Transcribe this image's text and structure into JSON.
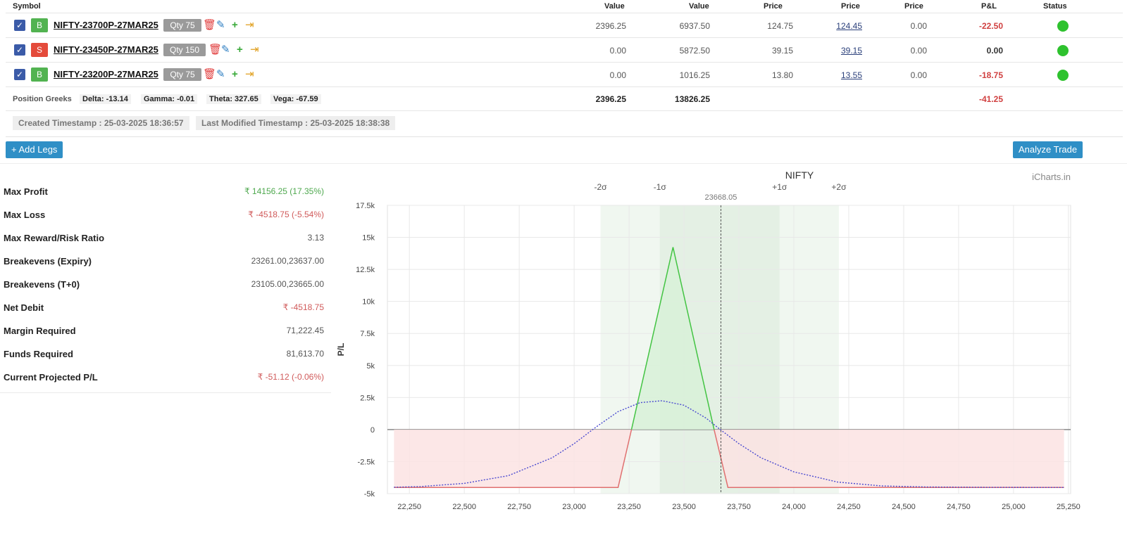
{
  "table": {
    "headers": {
      "symbol": "Symbol",
      "value1": "Value",
      "value2": "Value",
      "price1": "Price",
      "price2": "Price",
      "price3": "Price",
      "pnl": "P&L",
      "status": "Status"
    },
    "rows": [
      {
        "side": "B",
        "symbol": "NIFTY-23700P-27MAR25",
        "qty": "Qty 75",
        "v1": "2396.25",
        "v2": "6937.50",
        "p1": "124.75",
        "p2": "124.45",
        "p3": "0.00",
        "pnl": "-22.50"
      },
      {
        "side": "S",
        "symbol": "NIFTY-23450P-27MAR25",
        "qty": "Qty 150",
        "v1": "0.00",
        "v2": "5872.50",
        "p1": "39.15",
        "p2": "39.15",
        "p3": "0.00",
        "pnl": "0.00"
      },
      {
        "side": "B",
        "symbol": "NIFTY-23200P-27MAR25",
        "qty": "Qty 75",
        "v1": "0.00",
        "v2": "1016.25",
        "p1": "13.80",
        "p2": "13.55",
        "p3": "0.00",
        "pnl": "-18.75"
      }
    ],
    "greeks": {
      "label": "Position Greeks",
      "delta": "Delta: -13.14",
      "gamma": "Gamma: -0.01",
      "theta": "Theta: 327.65",
      "vega": "Vega: -67.59",
      "total_v1": "2396.25",
      "total_v2": "13826.25",
      "total_pnl": "-41.25"
    },
    "created": "Created Timestamp : 25-03-2025 18:36:57",
    "modified": "Last Modified Timestamp : 25-03-2025 18:38:38"
  },
  "buttons": {
    "add_legs": "+ Add Legs",
    "analyze": "Analyze Trade"
  },
  "stats": [
    {
      "label": "Max Profit",
      "value": "₹ 14156.25 (17.35%)",
      "tone": "pos"
    },
    {
      "label": "Max Loss",
      "value": "₹ -4518.75 (-5.54%)",
      "tone": "neg"
    },
    {
      "label": "Max Reward/Risk Ratio",
      "value": "3.13",
      "tone": ""
    },
    {
      "label": "Breakevens (Expiry)",
      "value": "23261.00,23637.00",
      "tone": ""
    },
    {
      "label": "Breakevens (T+0)",
      "value": "23105.00,23665.00",
      "tone": ""
    },
    {
      "label": "Net Debit",
      "value": "₹ -4518.75",
      "tone": "neg"
    },
    {
      "label": "Margin Required",
      "value": "71,222.45",
      "tone": ""
    },
    {
      "label": "Funds Required",
      "value": "81,613.70",
      "tone": ""
    },
    {
      "label": "Current Projected P/L",
      "value": "₹ -51.12 (-0.06%)",
      "tone": "neg"
    }
  ],
  "chart_data": {
    "type": "line",
    "title": "NIFTY",
    "watermark": "iCharts.in",
    "ylabel": "P/L",
    "xlim": [
      22150,
      25260
    ],
    "ylim": [
      -5000,
      17500
    ],
    "xticks": [
      22250,
      22500,
      22750,
      23000,
      23250,
      23500,
      23750,
      24000,
      24250,
      24500,
      24750,
      25000,
      25250
    ],
    "xtick_labels": [
      "22,250",
      "22,500",
      "22,750",
      "23,000",
      "23,250",
      "23,500",
      "23,750",
      "24,000",
      "24,250",
      "24,500",
      "24,750",
      "25,000",
      "25,250"
    ],
    "yticks": [
      -5000,
      -2500,
      0,
      2500,
      5000,
      7500,
      10000,
      12500,
      15000,
      17500
    ],
    "ytick_labels": [
      "-5k",
      "-2.5k",
      "0",
      "2.5k",
      "5k",
      "7.5k",
      "10k",
      "12.5k",
      "15k",
      "17.5k"
    ],
    "spot": 23668.05,
    "spot_label": "23668.05",
    "sigma_bands": [
      {
        "label": "-2σ",
        "x": 23120
      },
      {
        "label": "-1σ",
        "x": 23390
      },
      {
        "label": "+1σ",
        "x": 23935
      },
      {
        "label": "+2σ",
        "x": 24205
      }
    ],
    "series": [
      {
        "style": "solid",
        "color": "#e07070",
        "fill_neg": "#fbe3e3",
        "fill_pos": "#d8f1d8",
        "pos_color": "#43c443",
        "x": [
          22180,
          23200,
          23450,
          23700,
          25230
        ],
        "y": [
          -4518.75,
          -4518.75,
          14231.25,
          -4518.75,
          -4518.75
        ]
      },
      {
        "style": "dotted",
        "color": "#4a4ad0",
        "x": [
          22180,
          22300,
          22500,
          22700,
          22900,
          23000,
          23100,
          23200,
          23300,
          23400,
          23500,
          23600,
          23665,
          23750,
          23850,
          24000,
          24200,
          24400,
          24600,
          24900,
          25230
        ],
        "y": [
          -4500,
          -4450,
          -4200,
          -3600,
          -2200,
          -1100,
          200,
          1400,
          2100,
          2250,
          1900,
          900,
          0,
          -1100,
          -2200,
          -3300,
          -4100,
          -4400,
          -4480,
          -4510,
          -4518
        ]
      }
    ]
  }
}
